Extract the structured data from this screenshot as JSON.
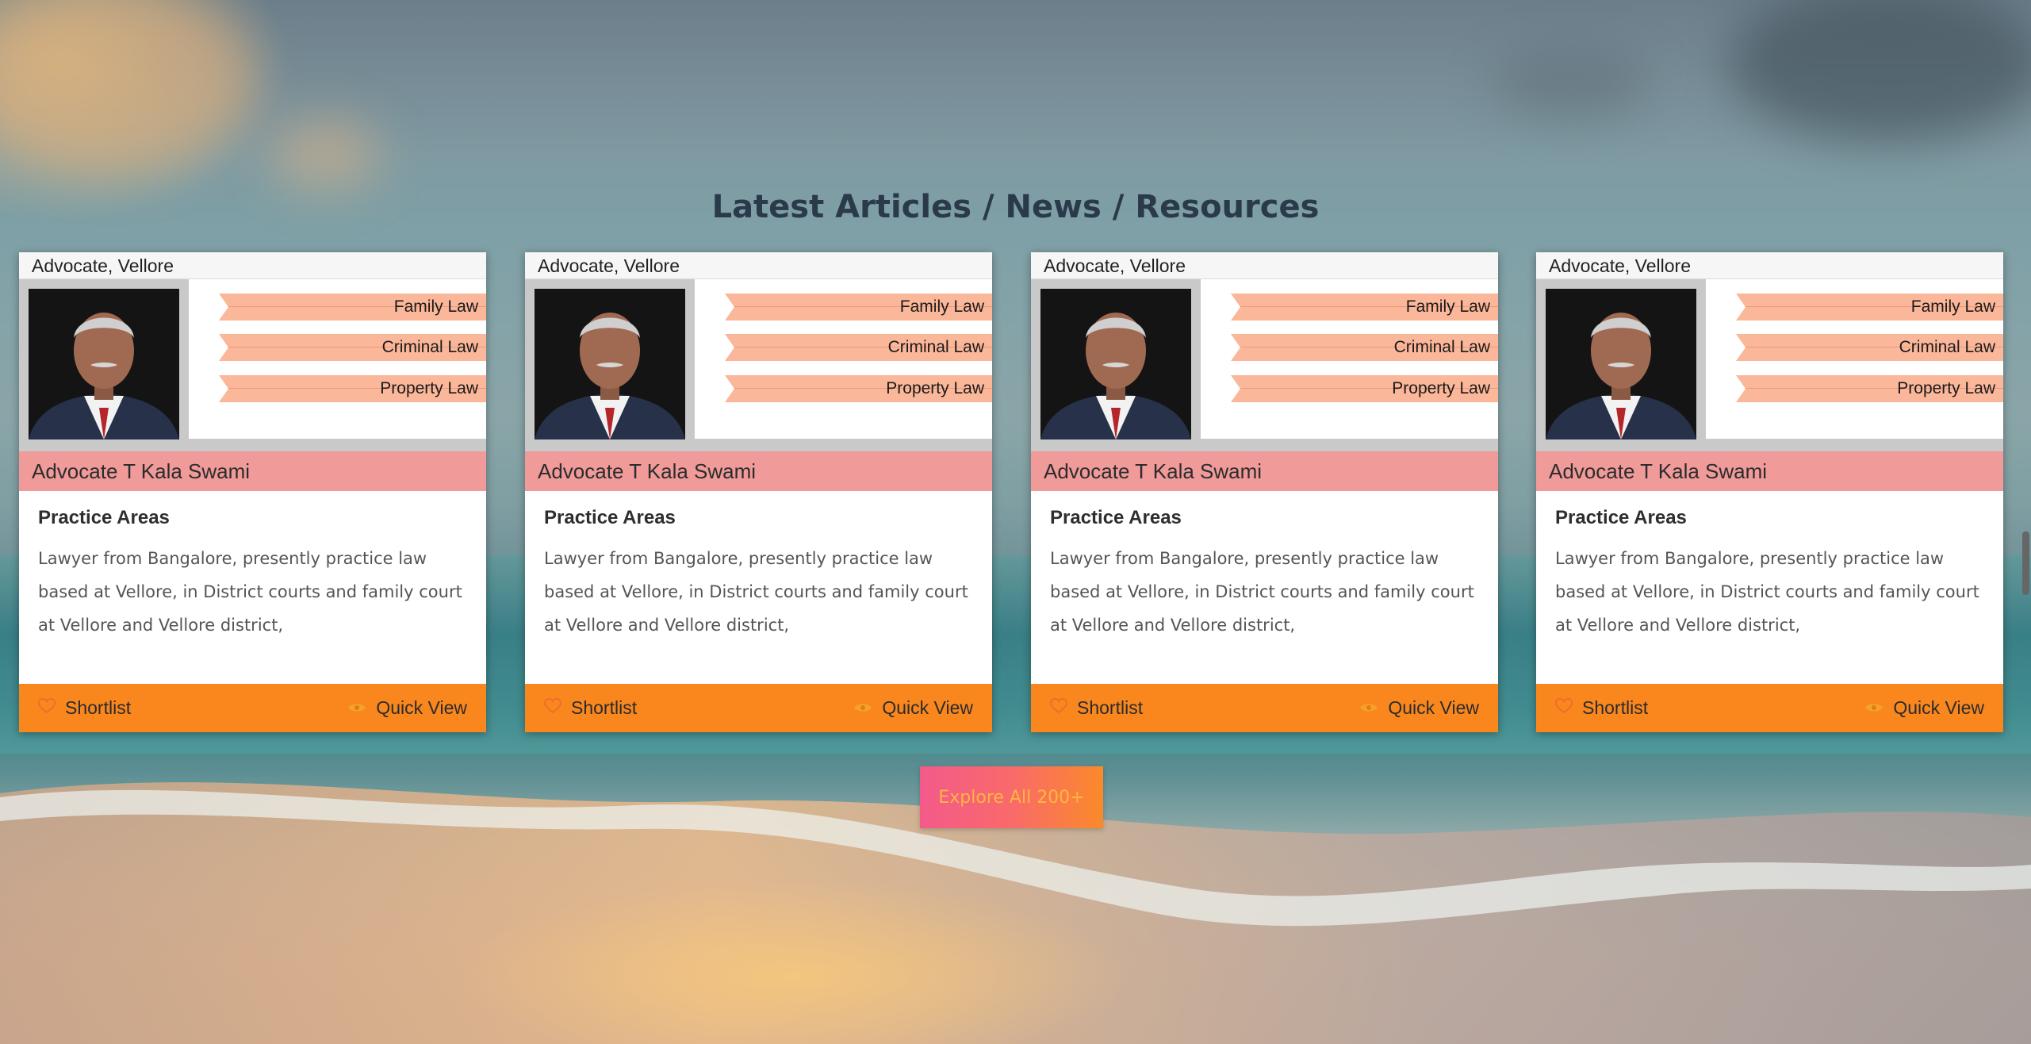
{
  "section": {
    "title": "Latest Articles / News / Resources"
  },
  "cards": [
    {
      "location": "Advocate, Vellore",
      "tags": [
        "Family Law",
        "Criminal Law",
        "Property Law"
      ],
      "name": "Advocate T Kala Swami",
      "practice_title": "Practice Areas",
      "practice_text": "Lawyer from Bangalore, presently practice law based at Vellore, in District courts and family court at Vellore and Vellore district,",
      "shortlist_label": "Shortlist",
      "quickview_label": "Quick View"
    },
    {
      "location": "Advocate, Vellore",
      "tags": [
        "Family Law",
        "Criminal Law",
        "Property Law"
      ],
      "name": "Advocate T Kala Swami",
      "practice_title": "Practice Areas",
      "practice_text": "Lawyer from Bangalore, presently practice law based at Vellore, in District courts and family court at Vellore and Vellore district,",
      "shortlist_label": "Shortlist",
      "quickview_label": "Quick View"
    },
    {
      "location": "Advocate, Vellore",
      "tags": [
        "Family Law",
        "Criminal Law",
        "Property Law"
      ],
      "name": "Advocate T Kala Swami",
      "practice_title": "Practice Areas",
      "practice_text": "Lawyer from Bangalore, presently practice law based at Vellore, in District courts and family court at Vellore and Vellore district,",
      "shortlist_label": "Shortlist",
      "quickview_label": "Quick View"
    },
    {
      "location": "Advocate, Vellore",
      "tags": [
        "Family Law",
        "Criminal Law",
        "Property Law"
      ],
      "name": "Advocate T Kala Swami",
      "practice_title": "Practice Areas",
      "practice_text": "Lawyer from Bangalore, presently practice law based at Vellore, in District courts and family court at Vellore and Vellore district,",
      "shortlist_label": "Shortlist",
      "quickview_label": "Quick View"
    }
  ],
  "explore_button": {
    "label": "Explore All 200+"
  },
  "icons": {
    "shortlist": "heart-icon",
    "quickview": "eye-icon"
  },
  "colors": {
    "tag_bg": "#fbb79a",
    "name_bar": "#f09a9a",
    "footer": "#f9871e",
    "title": "#2a3a4a"
  }
}
